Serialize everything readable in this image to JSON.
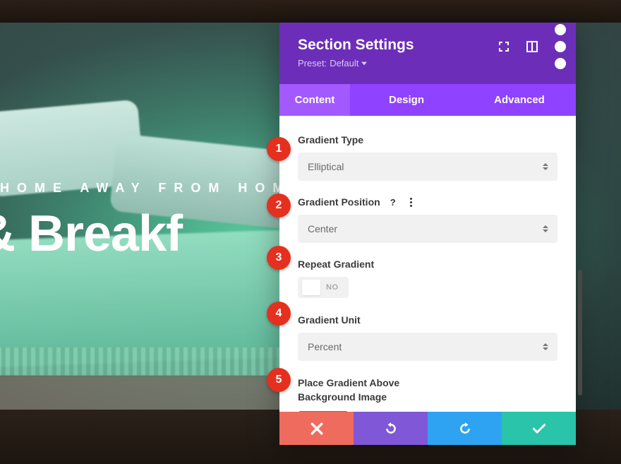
{
  "hero": {
    "tagline": "HOME AWAY FROM HOM",
    "title": "d & Breakf"
  },
  "panel": {
    "title": "Section Settings",
    "preset_prefix": "Preset:",
    "preset_value": "Default"
  },
  "tabs": {
    "content": "Content",
    "design": "Design",
    "advanced": "Advanced"
  },
  "fields": {
    "gradient_type": {
      "label": "Gradient Type",
      "value": "Elliptical"
    },
    "gradient_position": {
      "label": "Gradient Position",
      "value": "Center"
    },
    "repeat_gradient": {
      "label": "Repeat Gradient",
      "value": "NO"
    },
    "gradient_unit": {
      "label": "Gradient Unit",
      "value": "Percent"
    },
    "gradient_above": {
      "label": "Place Gradient Above Background Image",
      "value": "YES"
    }
  },
  "badges": {
    "b1": "1",
    "b2": "2",
    "b3": "3",
    "b4": "4",
    "b5": "5"
  },
  "colors": {
    "accent_purple": "#8f42ff",
    "accent_purple_dark": "#6c2eb9",
    "active_tab": "#a259ff",
    "toggle_on": "#2b87da",
    "badge": "#e5301f",
    "save": "#29c4a9",
    "redo": "#2ea3f2",
    "undo": "#8057d7",
    "cancel": "#ef6b5e"
  }
}
